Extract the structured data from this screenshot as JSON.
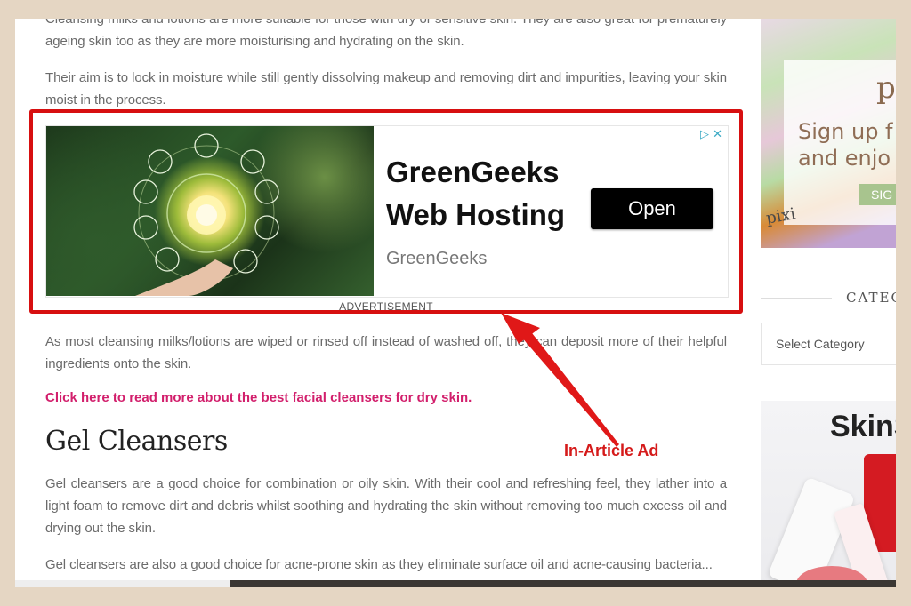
{
  "article": {
    "paragraphs": {
      "p1": "Cleansing milks and lotions are more suitable for those with dry or sensitive skin. They are also great for prematurely ageing skin too as they are more moisturising and hydrating on the skin.",
      "p2": "Their aim is to lock in moisture while still gently dissolving makeup and removing dirt and impurities, leaving your skin moist in the process.",
      "p3": "As most cleansing milks/lotions are wiped or rinsed off instead of washed off, they can deposit more of their helpful ingredients onto the skin.",
      "p4": "Gel cleansers are a good choice for combination or oily skin. With their cool and refreshing feel, they lather into a light foam to remove dirt and debris whilst soothing and hydrating the skin without removing too much excess oil and drying out the skin.",
      "p5": "Gel cleansers are also a good choice for acne-prone skin as they eliminate surface oil and acne-causing bacteria..."
    },
    "link_text": "Click here to read more about the best facial cleansers for dry skin.",
    "heading": "Gel Cleansers"
  },
  "ad": {
    "title": "GreenGeeks Web Hosting",
    "brand": "GreenGeeks",
    "cta_label": "Open",
    "choices_icon": "adchoices-icon",
    "close_icon": "close-icon",
    "label": "ADVERTISEMENT"
  },
  "annotation": {
    "label": "In-Article Ad",
    "color": "#d51a1a"
  },
  "sidebar": {
    "promo1": {
      "logo": "pi",
      "text_line1": "Sign up f",
      "text_line2": "and enjo",
      "button": "SIG",
      "product": "pixi"
    },
    "categories": {
      "title": "CATEGORIES",
      "select_value": "Select Category"
    },
    "promo2": {
      "text": "SkinS"
    }
  },
  "colors": {
    "frame": "#e5d6c3",
    "ad_border": "#d70f10",
    "link": "#d21f6c",
    "cta_bg": "#000000"
  }
}
